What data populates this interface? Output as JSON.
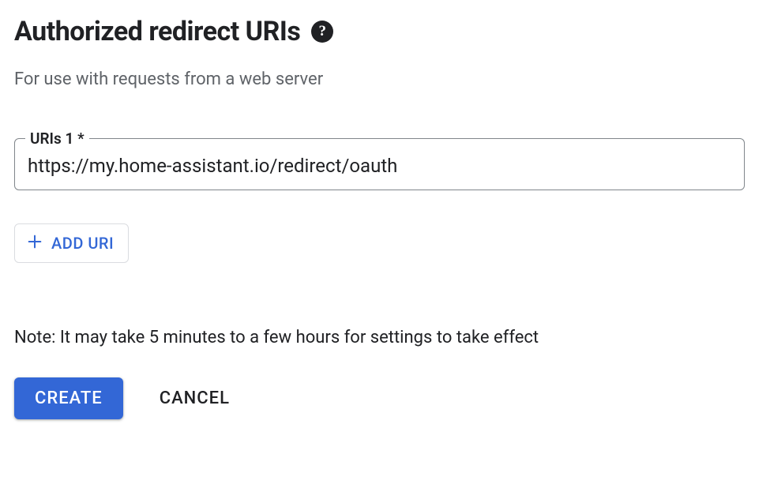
{
  "section": {
    "title": "Authorized redirect URIs",
    "subtitle": "For use with requests from a web server"
  },
  "uri_field": {
    "label": "URIs 1 *",
    "value": "https://my.home-assistant.io/redirect/oauth"
  },
  "add_button": {
    "label": "ADD URI"
  },
  "note": "Note: It may take 5 minutes to a few hours for settings to take effect",
  "actions": {
    "create": "CREATE",
    "cancel": "CANCEL"
  }
}
